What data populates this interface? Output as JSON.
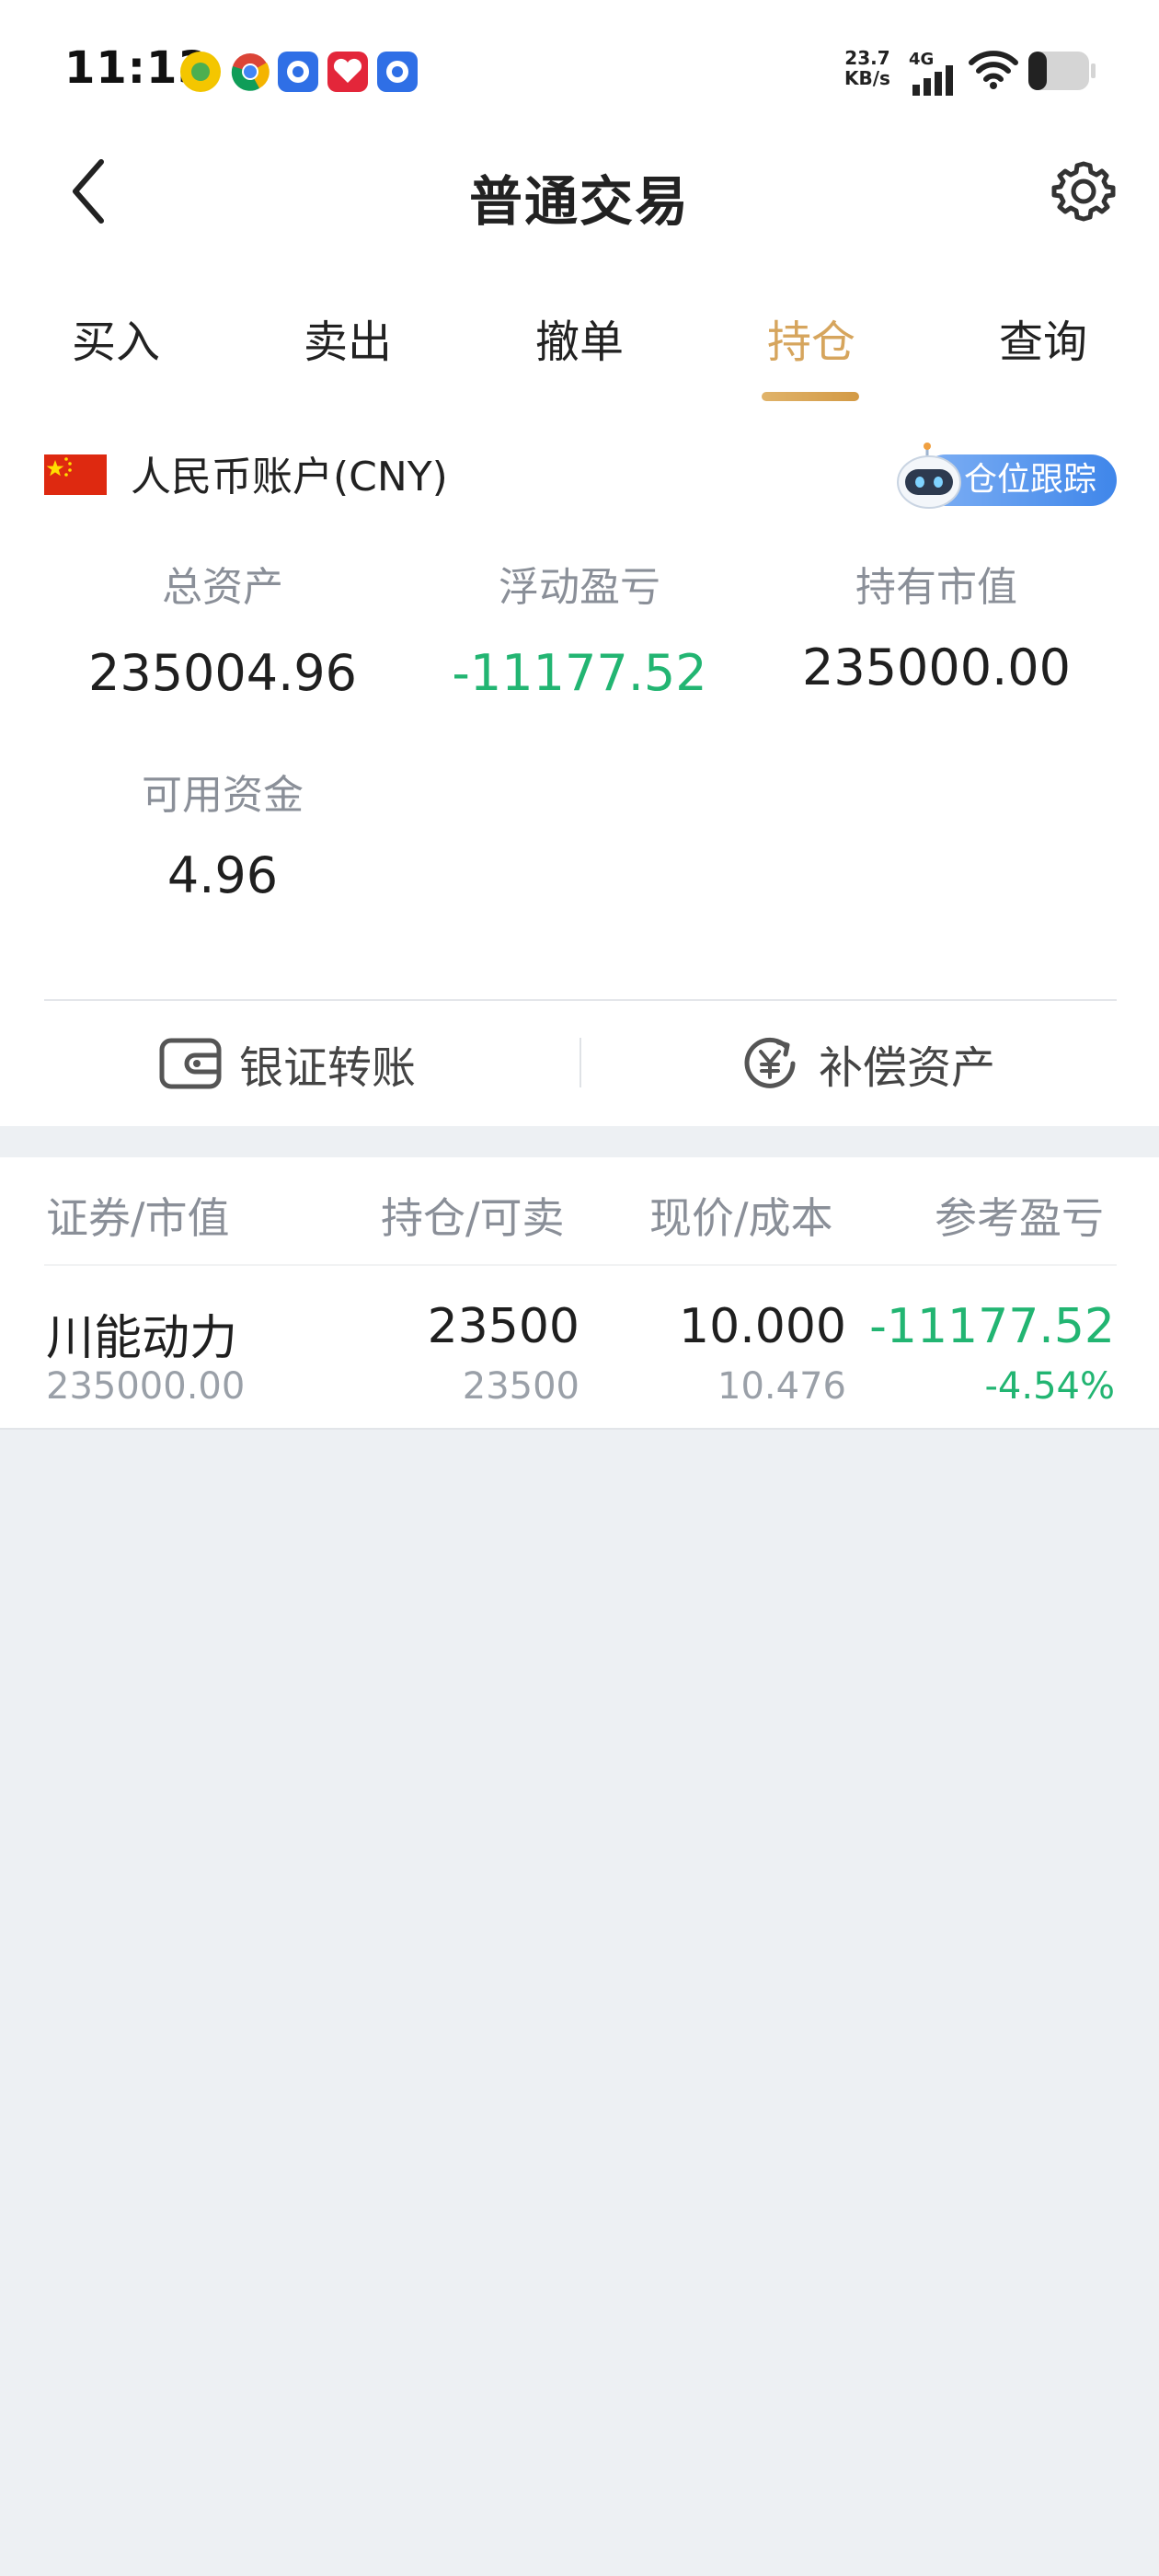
{
  "status_bar": {
    "time": "11:13",
    "net_speed_value": "23.7",
    "net_speed_unit": "KB/s",
    "network_type": "4G"
  },
  "header": {
    "title": "普通交易"
  },
  "tabs": [
    {
      "label": "买入",
      "active": false
    },
    {
      "label": "卖出",
      "active": false
    },
    {
      "label": "撤单",
      "active": false
    },
    {
      "label": "持仓",
      "active": true
    },
    {
      "label": "查询",
      "active": false
    }
  ],
  "account": {
    "name": "人民币账户(CNY)",
    "tracking_label": "仓位跟踪"
  },
  "summary": {
    "total_assets_label": "总资产",
    "total_assets_value": "235004.96",
    "floating_pl_label": "浮动盈亏",
    "floating_pl_value": "-11177.52",
    "market_value_label": "持有市值",
    "market_value_value": "235000.00",
    "available_funds_label": "可用资金",
    "available_funds_value": "4.96"
  },
  "actions": {
    "bank_transfer": "银证转账",
    "compensation_assets": "补偿资产"
  },
  "holdings": {
    "columns": [
      "证券/市值",
      "持仓/可卖",
      "现价/成本",
      "参考盈亏"
    ],
    "rows": [
      {
        "name": "川能动力",
        "market_value": "235000.00",
        "position": "23500",
        "available": "23500",
        "price": "10.000",
        "cost": "10.476",
        "pl": "-11177.52",
        "pl_pct": "-4.54%"
      }
    ]
  },
  "colors": {
    "accent": "#d6a55d",
    "loss_green": "#22b572",
    "tracking_blue": "#3f86ea",
    "page_bg": "#edf0f3"
  }
}
